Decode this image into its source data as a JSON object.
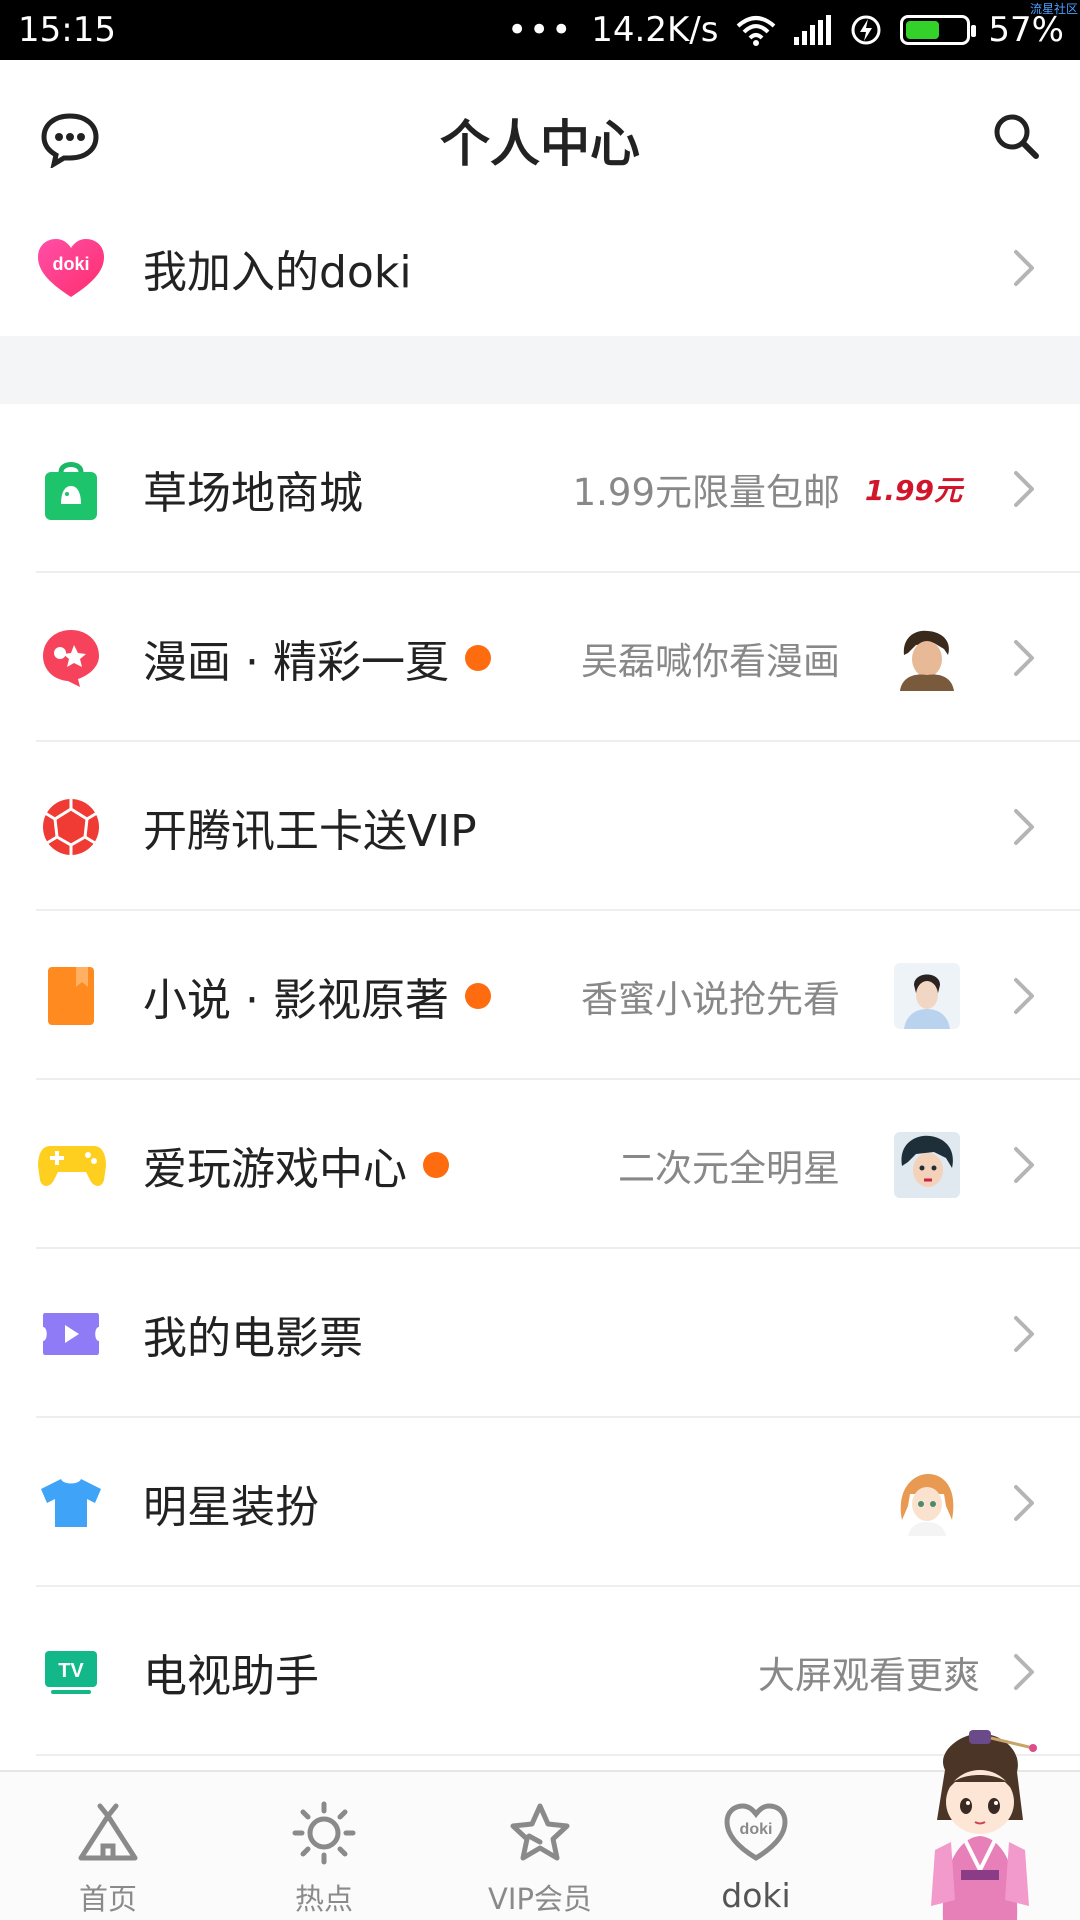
{
  "status_bar": {
    "time": "15:15",
    "dots": "•••",
    "speed": "14.2K/s",
    "battery": "57%",
    "battery_level": 0.57,
    "watermark": "流星社区"
  },
  "header": {
    "title": "个人中心",
    "left_icon": "message-icon",
    "right_icon": "search-icon"
  },
  "doki_row": {
    "label": "我加入的doki",
    "icon": "doki-heart-icon",
    "icon_text": "doki"
  },
  "menu": [
    {
      "label": "草场地商城",
      "sub": "1.99元限量包邮",
      "badge": "1.99元",
      "icon": "shopping-bag-icon",
      "dot": false
    },
    {
      "label": "漫画 · 精彩一夏",
      "sub": "吴磊喊你看漫画",
      "icon": "comic-icon",
      "dot": true,
      "thumb": "boy-portrait"
    },
    {
      "label": "开腾讯王卡送VIP",
      "sub": "",
      "icon": "wangka-icon",
      "dot": false
    },
    {
      "label": "小说 · 影视原著",
      "sub": "香蜜小说抢先看",
      "icon": "book-icon",
      "dot": true,
      "thumb": "actress-portrait"
    },
    {
      "label": "爱玩游戏中心",
      "sub": "二次元全明星",
      "icon": "gamepad-icon",
      "dot": true,
      "thumb": "anime-boy"
    },
    {
      "label": "我的电影票",
      "sub": "",
      "icon": "ticket-icon",
      "dot": false
    },
    {
      "label": "明星装扮",
      "sub": "",
      "icon": "tshirt-icon",
      "dot": false,
      "thumb": "anime-girl"
    },
    {
      "label": "电视助手",
      "sub": "大屏观看更爽",
      "icon": "tv-icon",
      "icon_text": "TV",
      "dot": false
    }
  ],
  "tabs": [
    {
      "label": "首页",
      "icon": "tent-home-icon"
    },
    {
      "label": "热点",
      "icon": "sun-hot-icon"
    },
    {
      "label": "VIP会员",
      "icon": "star-vip-icon"
    },
    {
      "label": "doki",
      "icon": "doki-heart-icon"
    }
  ],
  "colors": {
    "accent_dot": "#ff6b0f",
    "battery_green": "#33d12a",
    "price_red": "#d1162b",
    "divider": "#eeeeee",
    "gap_bg": "#f4f5f7"
  }
}
